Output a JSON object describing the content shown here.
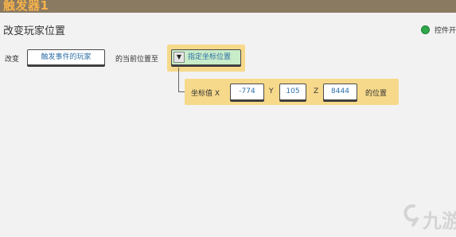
{
  "window": {
    "title": "触发器1"
  },
  "panel": {
    "title": "改变玩家位置",
    "toggle": {
      "label": "控件开",
      "state_color": "#2ea84a"
    }
  },
  "action_row": {
    "prefix_label": "改变",
    "target_button": "触发事件的玩家",
    "middle_label": "的当前位置至",
    "dropdown": {
      "arrow": "▼",
      "selected": "指定坐标位置"
    }
  },
  "coord_row": {
    "label": "坐标值 X",
    "x_value": "-774",
    "y_label": "Y",
    "y_value": "105",
    "z_label": "Z",
    "z_value": "8444",
    "suffix_label": "的位置"
  },
  "watermark": {
    "text": "九游",
    "icon": "j-logo-icon"
  },
  "colors": {
    "accent_orange": "#f6b24a",
    "highlight": "#f6d98a",
    "value_blue": "#2d6fa8",
    "dropdown_green": "#c9ecc9"
  }
}
